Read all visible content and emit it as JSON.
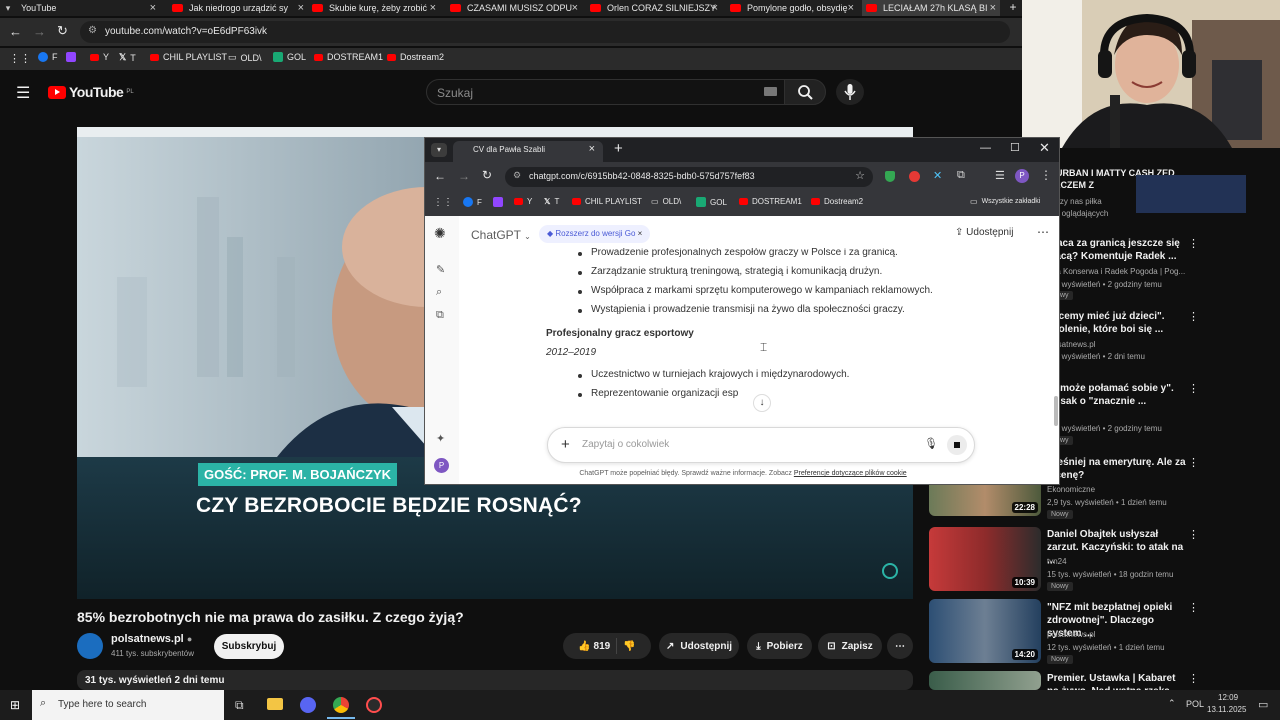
{
  "browser": {
    "tabs": [
      {
        "label": "YouTube",
        "active": false
      },
      {
        "label": "Jak niedrogo urządzić sy",
        "active": false
      },
      {
        "label": "Skubie kurę, żeby zrobić",
        "active": false
      },
      {
        "label": "CZASAMI MUSISZ ODPU",
        "active": false
      },
      {
        "label": "Orlen CORAZ SILNIEJSZY",
        "active": false
      },
      {
        "label": "Pomylone godło, obsydię",
        "active": false
      },
      {
        "label": "LECIAŁAM 27h KLASĄ BI",
        "active": true
      }
    ],
    "url": "youtube.com/watch?v=oE6dPF63ivk",
    "bookmarks": [
      "F",
      "Y",
      "T",
      "CHIL PLAYLIST",
      "OLD\\",
      "GOL",
      "DOSTREAM1",
      "Dostream2"
    ]
  },
  "youtube": {
    "logo": "YouTube",
    "logo_sup": "PL",
    "search_placeholder": "Szukaj",
    "video": {
      "guest_badge": "GOŚĆ: PROF. M. BOJAŃCZYK",
      "headline": "CZY BEZROBOCIE BĘDZIE ROSNĄĆ?"
    },
    "title": "85% bezrobotnych nie ma prawa do zasiłku. Z czego żyją?",
    "channel": "polsatnews.pl",
    "subscribers": "411 tys. subskrybentów",
    "subscribe_label": "Subskrybuj",
    "likes": "819",
    "share_label": "Udostępnij",
    "download_label": "Pobierz",
    "save_label": "Zapisz",
    "desc_meta": "31 tys. wyświetleń  2 dni temu",
    "sidebar": [
      {
        "title": "N URBAN I MATTY CASH ZED MECZEM Z",
        "channel": "Łączy nas piłka",
        "meta": "tys. oglądających",
        "badge": "",
        "duration": ""
      },
      {
        "title": "praca za granicą jeszcze się ...acą? Komentuje Radek ...",
        "channel": "arta Konserwa i Radek Pogoda | Pog...",
        "meta": "tys. wyświetleń • 2 godziny temu",
        "badge": "Nowy",
        "duration": ""
      },
      {
        "title": "chcemy mieć już dzieci\". koolenie, które boi się ...",
        "channel": "polsatnews.pl",
        "meta": "tys. wyświetleń • 2 dni temu",
        "badge": "",
        "duration": ""
      },
      {
        "title": "k \"może połamać sobie y\". Bosak o \"znacznie ...",
        "channel": "24",
        "meta": "tys. wyświetleń • 2 godziny temu",
        "badge": "Nowy",
        "duration": ""
      },
      {
        "title": "cześniej na emeryturę. Ale za ą cenę?",
        "channel": "Ekonomiczne",
        "meta": "2,9 tys. wyświetleń • 1 dzień temu",
        "badge": "Nowy",
        "duration": "22:28"
      },
      {
        "title": "Daniel Obajtek usłyszał zarzut. Kaczyński: to atak na ...",
        "channel": "tvn24",
        "meta": "15 tys. wyświetleń • 18 godzin temu",
        "badge": "Nowy",
        "duration": "10:39"
      },
      {
        "title": "\"NFZ mit bezpłatnej opieki zdrowotnej\". Dlaczego system ...",
        "channel": "polsatnews.pl",
        "meta": "12 tys. wyświetleń • 1 dzień temu",
        "badge": "Nowy",
        "duration": "14:20"
      },
      {
        "title": "Premier. Ustawka | Kabaret na żywo. Nad watną rzeka",
        "channel": "",
        "meta": "",
        "badge": "",
        "duration": ""
      }
    ]
  },
  "chatgpt": {
    "window_tab": "CV dla Pawła Szabli",
    "url": "chatgpt.com/c/6915bb42-0848-8325-bdb0-575d757fef83",
    "bookmarks": [
      "F",
      "Y",
      "T",
      "CHIL PLAYLIST",
      "OLD\\",
      "GOL",
      "DOSTREAM1",
      "Dostream2"
    ],
    "all_bookmarks": "Wszystkie zakładki",
    "model": "ChatGPT",
    "upgrade": "Rozszerz do wersji Go",
    "share": "Udostępnij",
    "bullets_top": [
      "Prowadzenie profesjonalnych zespołów graczy w Polsce i za granicą.",
      "Zarządzanie strukturą treningową, strategią i komunikacją drużyn.",
      "Współpraca z markami sprzętu komputerowego w kampaniach reklamowych.",
      "Wystąpienia i prowadzenie transmisji na żywo dla społeczności graczy."
    ],
    "section_title": "Profesjonalny gracz esportowy",
    "section_years": "2012–2019",
    "bullets_bottom": [
      "Uczestnictwo w turniejach krajowych i międzynarodowych.",
      "Reprezentowanie organizacji esp"
    ],
    "input_placeholder": "Zapytaj o cokolwiek",
    "disclaimer": "ChatGPT może popełniać błędy. Sprawdź ważne informacje. Zobacz",
    "disclaimer_link": "Preferencje dotyczące plików cookie",
    "avatar": "P"
  },
  "taskbar": {
    "search_placeholder": "Type here to search",
    "language": "POL",
    "time": "12:09",
    "date": "13.11.2025"
  },
  "colors": {
    "youtube_red": "#ff0000",
    "badge_teal": "#2bb3a6",
    "upgrade_blue": "#4a5ad6"
  }
}
